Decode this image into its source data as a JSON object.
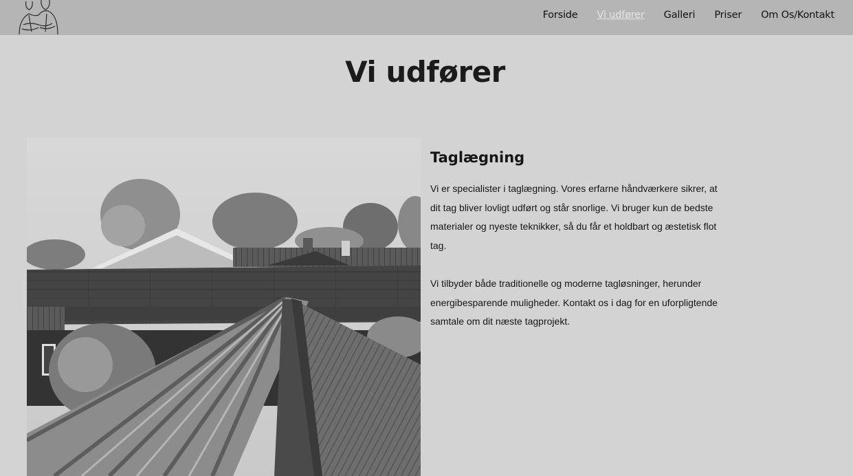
{
  "nav": {
    "items": [
      {
        "label": "Forside",
        "active": false
      },
      {
        "label": "Vi udfører",
        "active": true
      },
      {
        "label": "Galleri",
        "active": false
      },
      {
        "label": "Priser",
        "active": false
      },
      {
        "label": "Om Os/Kontakt",
        "active": false
      }
    ]
  },
  "page": {
    "title": "Vi udfører"
  },
  "service": {
    "title": "Taglægning",
    "paragraphs": [
      "Vi er specialister i taglægning. Vores erfarne håndværkere sikrer, at dit tag bliver lovligt udført og står snorlige. Vi bruger kun de bedste materialer og nyeste teknikker, så du får et holdbart og æstetisk flot tag.",
      "Vi tilbyder både traditionelle og moderne tagløsninger, herunder energibesparende muligheder. Kontakt os i dag for en uforpligtende samtale om dit næste tagprojekt."
    ],
    "image": "roof-construction-photo"
  },
  "colors": {
    "topbar": "#b5b5b5",
    "background": "#d3d3d3",
    "active_link": "#e6e6e6"
  }
}
